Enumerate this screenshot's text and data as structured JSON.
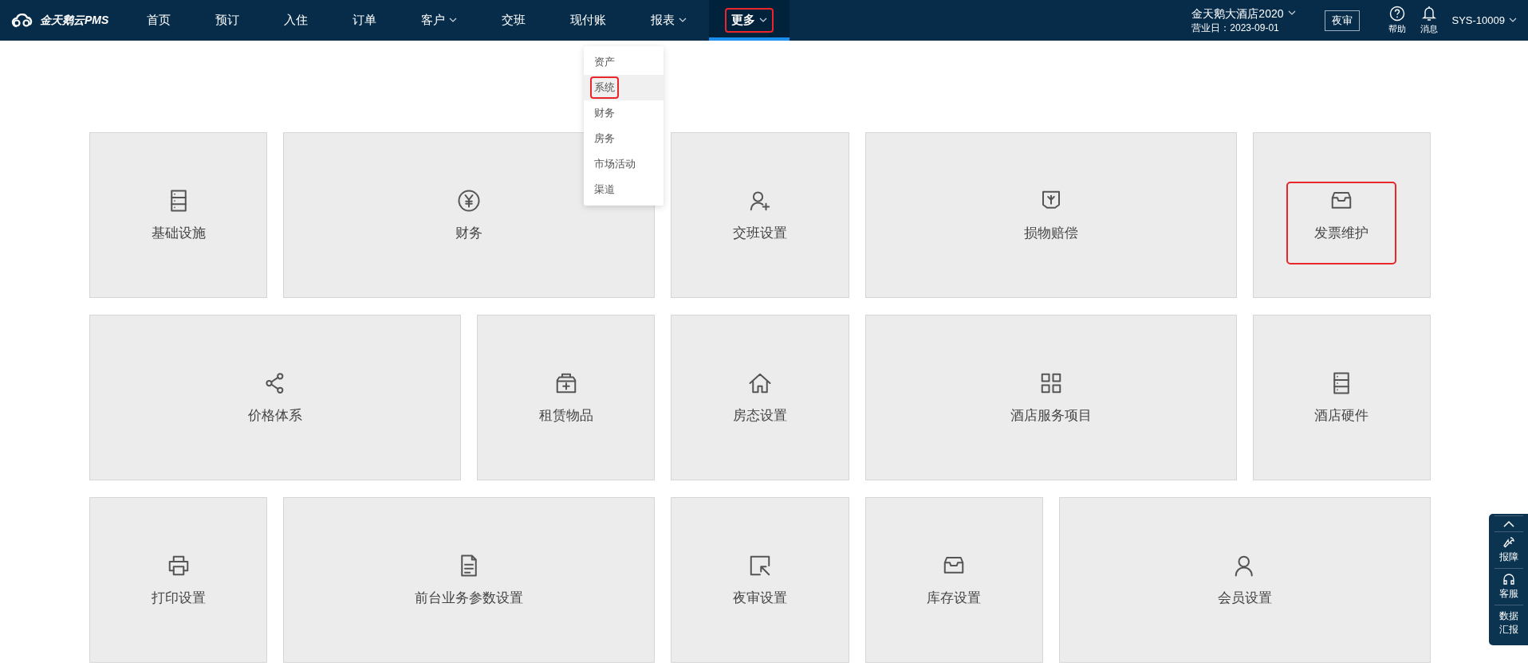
{
  "header": {
    "logo": "金天鹅云PMS",
    "nav": [
      {
        "label": "首页",
        "has_menu": false,
        "selected": false,
        "highlighted": false
      },
      {
        "label": "预订",
        "has_menu": false,
        "selected": false,
        "highlighted": false
      },
      {
        "label": "入住",
        "has_menu": false,
        "selected": false,
        "highlighted": false
      },
      {
        "label": "订单",
        "has_menu": false,
        "selected": false,
        "highlighted": false
      },
      {
        "label": "客户",
        "has_menu": true,
        "selected": false,
        "highlighted": false
      },
      {
        "label": "交班",
        "has_menu": false,
        "selected": false,
        "highlighted": false
      },
      {
        "label": "现付账",
        "has_menu": false,
        "selected": false,
        "highlighted": false
      },
      {
        "label": "报表",
        "has_menu": true,
        "selected": false,
        "highlighted": false
      },
      {
        "label": "更多",
        "has_menu": true,
        "selected": true,
        "highlighted": true
      }
    ],
    "hotel": "金天鹅大酒店2020",
    "business_day": "营业日：2023-09-01",
    "night_audit": "夜审",
    "help": "帮助",
    "messages": "消息",
    "user": "SYS-10009"
  },
  "dropdown": [
    {
      "label": "资产",
      "selected": false,
      "highlighted": false
    },
    {
      "label": "系统",
      "selected": true,
      "highlighted": true
    },
    {
      "label": "财务",
      "selected": false,
      "highlighted": false
    },
    {
      "label": "房务",
      "selected": false,
      "highlighted": false
    },
    {
      "label": "市场活动",
      "selected": false,
      "highlighted": false
    },
    {
      "label": "渠道",
      "selected": false,
      "highlighted": false
    }
  ],
  "tiles": [
    {
      "label": "基础设施",
      "wide": false,
      "highlighted": false
    },
    {
      "label": "财务",
      "wide": true,
      "highlighted": false
    },
    {
      "label": "交班设置",
      "wide": false,
      "highlighted": false
    },
    {
      "label": "损物赔偿",
      "wide": true,
      "highlighted": false
    },
    {
      "label": "发票维护",
      "wide": false,
      "highlighted": true
    },
    {
      "label": "价格体系",
      "wide": true,
      "highlighted": false
    },
    {
      "label": "租赁物品",
      "wide": false,
      "highlighted": false
    },
    {
      "label": "房态设置",
      "wide": false,
      "highlighted": false
    },
    {
      "label": "酒店服务项目",
      "wide": true,
      "highlighted": false
    },
    {
      "label": "酒店硬件",
      "wide": false,
      "highlighted": false
    },
    {
      "label": "打印设置",
      "wide": false,
      "highlighted": false
    },
    {
      "label": "前台业务参数设置",
      "wide": true,
      "highlighted": false
    },
    {
      "label": "夜审设置",
      "wide": false,
      "highlighted": false
    },
    {
      "label": "库存设置",
      "wide": false,
      "highlighted": false
    },
    {
      "label": "会员设置",
      "wide": true,
      "highlighted": false
    }
  ],
  "side_panel": [
    {
      "kind": "top"
    },
    {
      "kind": "item",
      "label": "报障"
    },
    {
      "kind": "item",
      "label": "客服"
    },
    {
      "kind": "text",
      "label": "数据汇报"
    }
  ]
}
